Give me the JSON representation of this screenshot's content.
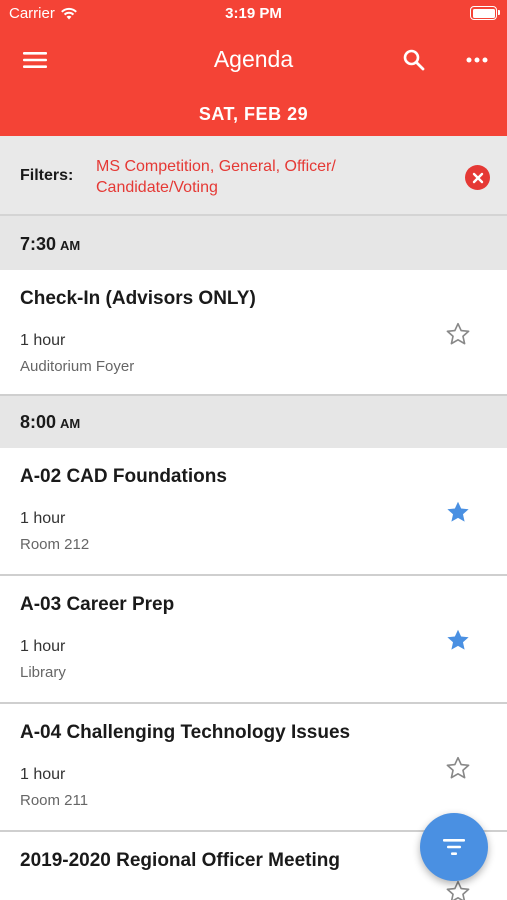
{
  "status_bar": {
    "carrier": "Carrier",
    "time": "3:19 PM"
  },
  "app_bar": {
    "title": "Agenda"
  },
  "date_header": "SAT, FEB 29",
  "filters": {
    "label": "Filters:",
    "value": "MS Competition, General, Officer/ Candidate/Voting"
  },
  "time_headers": [
    {
      "time": "7:30",
      "ampm": "AM"
    },
    {
      "time": "8:00",
      "ampm": "AM"
    }
  ],
  "sessions": [
    {
      "title": "Check-In (Advisors ONLY)",
      "duration": "1 hour",
      "location": "Auditorium Foyer",
      "starred": false
    },
    {
      "title": "A-02 CAD Foundations",
      "duration": "1 hour",
      "location": "Room 212",
      "starred": true
    },
    {
      "title": "A-03 Career Prep",
      "duration": "1 hour",
      "location": "Library",
      "starred": true
    },
    {
      "title": "A-04 Challenging Technology Issues",
      "duration": "1 hour",
      "location": "Room 211",
      "starred": false
    },
    {
      "title": "2019-2020 Regional Officer Meeting",
      "duration": "",
      "location": "",
      "starred": false
    }
  ],
  "colors": {
    "brand": "#f44336",
    "accent": "#4a90e2",
    "filter_text": "#e53935"
  },
  "icons": {
    "menu": "hamburger-icon",
    "search": "search-icon",
    "more": "more-horizontal-icon",
    "clear": "clear-circle-icon",
    "star_outline": "star-outline-icon",
    "star_filled": "star-filled-icon",
    "fab": "filter-icon"
  }
}
